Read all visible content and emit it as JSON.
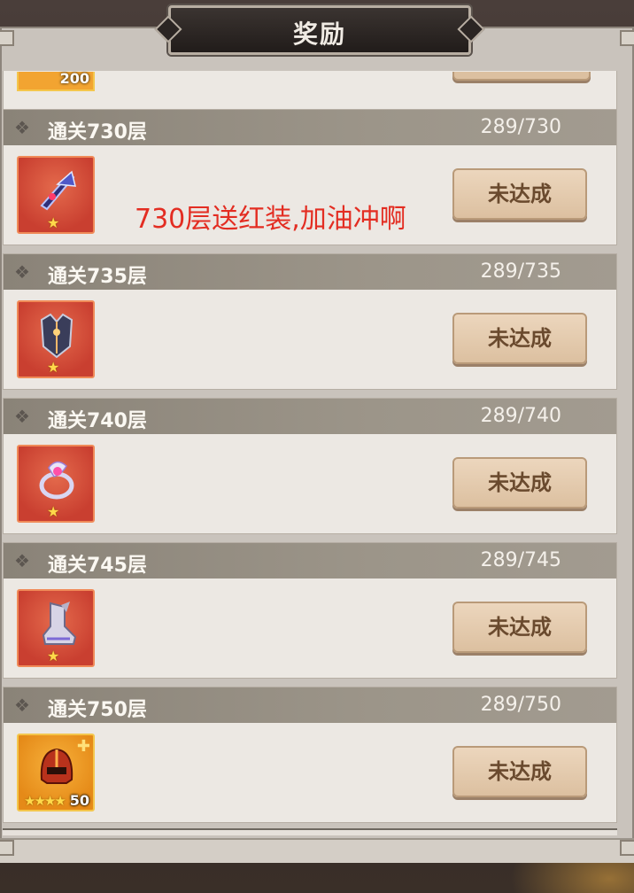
{
  "header": {
    "title": "奖励"
  },
  "top_partial": {
    "count": "200"
  },
  "overlay_note": "730层送红装,加油冲啊",
  "rewards": [
    {
      "title": "通关730层",
      "progress": "289/730",
      "button_label": "未达成",
      "item": "red-weapon-blade",
      "stars": "★",
      "count": ""
    },
    {
      "title": "通关735层",
      "progress": "289/735",
      "button_label": "未达成",
      "item": "red-armor-chest",
      "stars": "★",
      "count": ""
    },
    {
      "title": "通关740层",
      "progress": "289/740",
      "button_label": "未达成",
      "item": "red-ring",
      "stars": "★",
      "count": ""
    },
    {
      "title": "通关745层",
      "progress": "289/745",
      "button_label": "未达成",
      "item": "red-boots",
      "stars": "★",
      "count": ""
    },
    {
      "title": "通关750层",
      "progress": "289/750",
      "button_label": "未达成",
      "item": "gold-helmet-fragment",
      "stars": "★★★★",
      "count": "50"
    }
  ],
  "colors": {
    "accent_red": "#e32d22",
    "header_band": "#8a8378",
    "button_bg": "#dcc0a0",
    "red_frame": "#c93f30",
    "gold_frame": "#e58a18"
  }
}
